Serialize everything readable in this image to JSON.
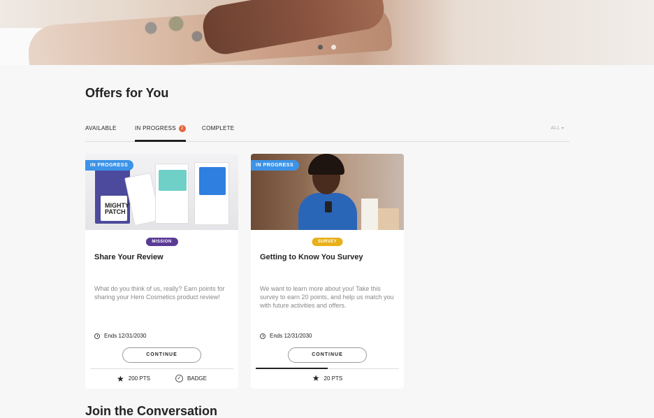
{
  "offers": {
    "title": "Offers for You",
    "tabs": [
      {
        "label": "AVAILABLE"
      },
      {
        "label": "IN PROGRESS",
        "count": "2"
      },
      {
        "label": "COMPLETE"
      }
    ],
    "active_tab": "IN PROGRESS",
    "filter": {
      "label": "ALL"
    }
  },
  "cards": [
    {
      "status": "IN PROGRESS",
      "type": "MISSION",
      "title": "Share Your Review",
      "description": "What do you think of us, really? Earn points for sharing your Hero Cosmetics product review!",
      "ends": "Ends 12/31/2030",
      "button": "CONTINUE",
      "progress": 0,
      "points": "200 PTS",
      "badge": "BADGE",
      "image_brand": "MIGHTY PATCH"
    },
    {
      "status": "IN PROGRESS",
      "type": "SURVEY",
      "title": "Getting to Know You Survey",
      "description": "We want to learn more about you! Take this survey to earn 20 points, and help us match you with future activities and offers.",
      "ends": "Ends 12/31/2030",
      "button": "CONTINUE",
      "progress": 0.5,
      "points": "20 PTS"
    }
  ],
  "join": {
    "title": "Join the Conversation"
  },
  "carousel": {
    "count": 2,
    "active": 0
  },
  "colors": {
    "status_blue": "#3c93e8",
    "mission_purple": "#5a3a95",
    "survey_yellow": "#e8b01a",
    "badge_orange": "#e8623d"
  }
}
